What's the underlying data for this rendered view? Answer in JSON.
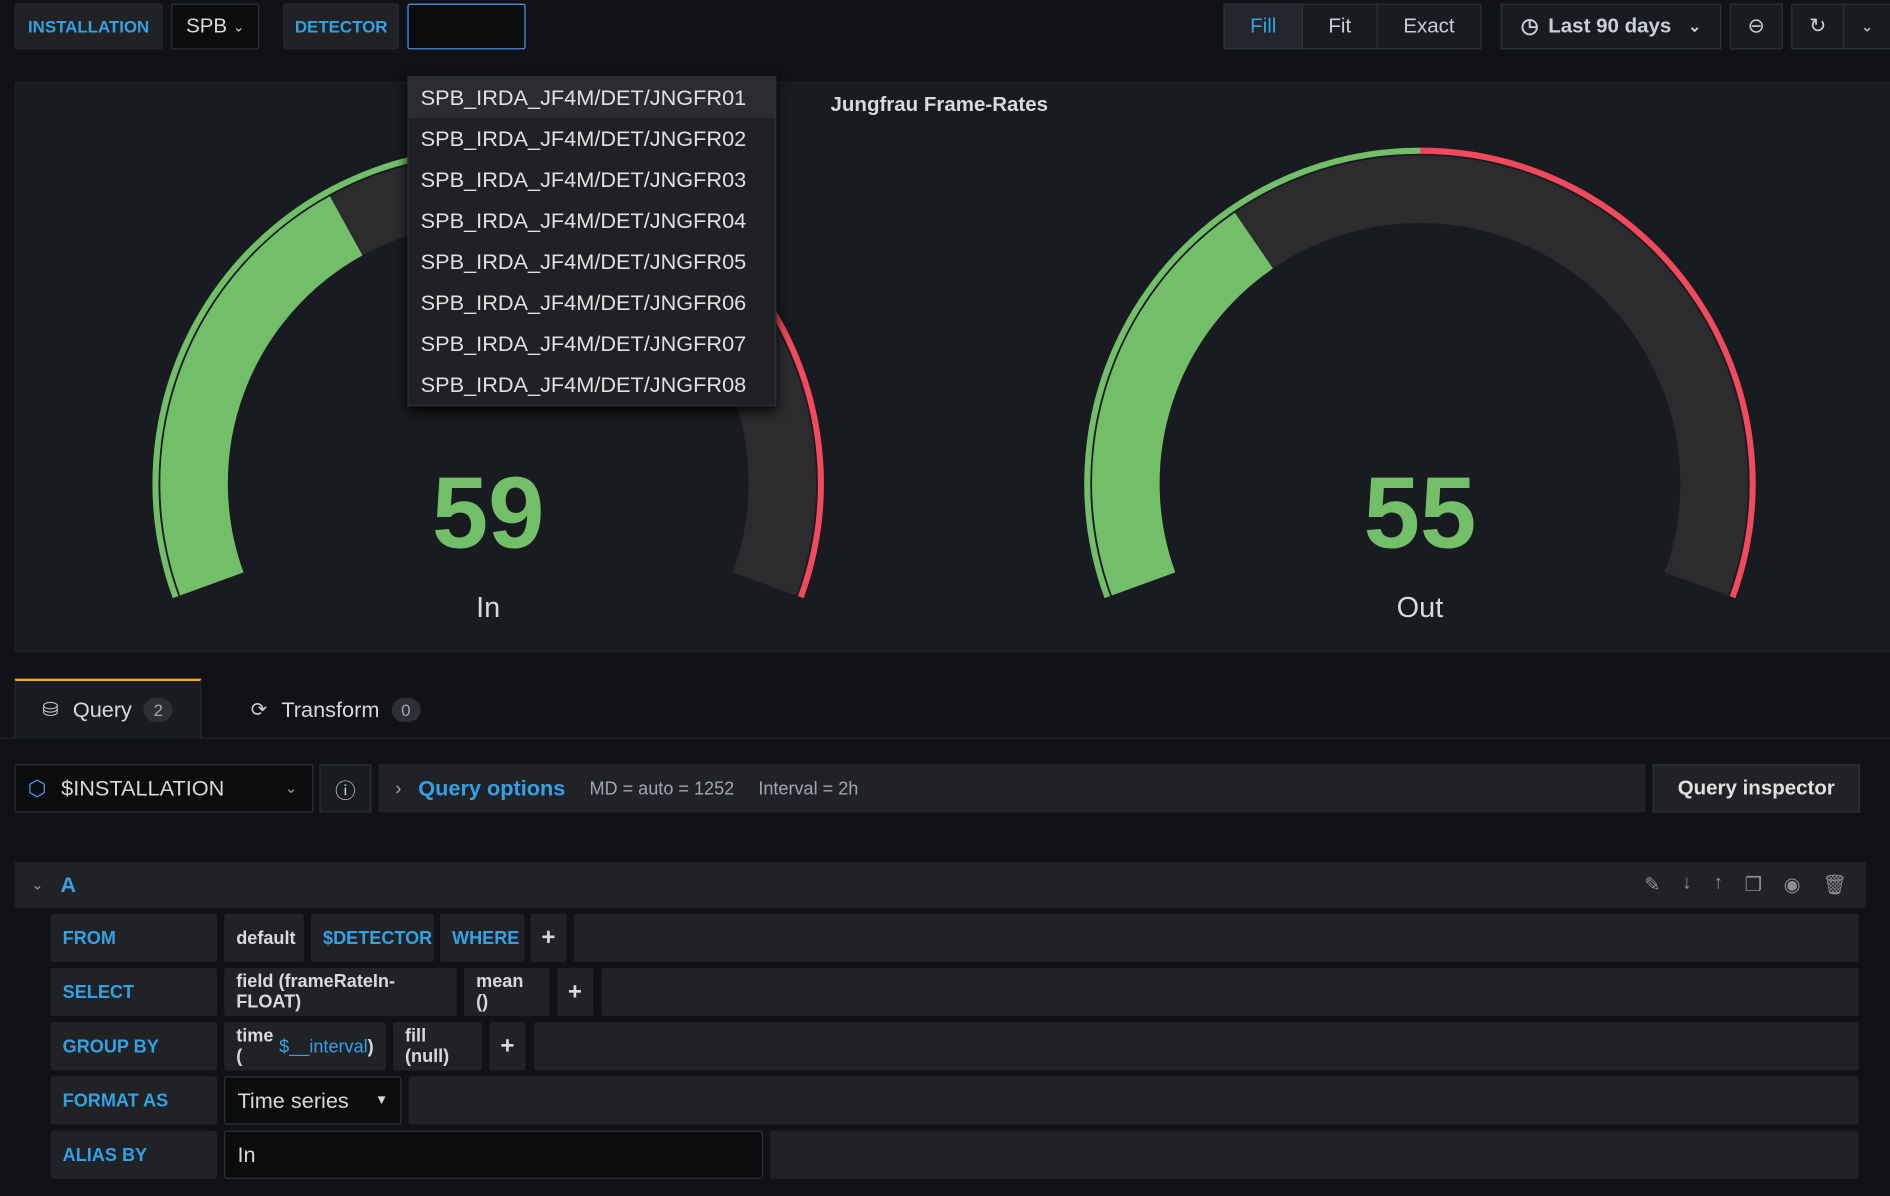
{
  "variables": {
    "installation_label": "INSTALLATION",
    "installation_value": "SPB",
    "detector_label": "DETECTOR",
    "detector_value": ""
  },
  "toolbar": {
    "fill": "Fill",
    "fit": "Fit",
    "exact": "Exact",
    "time_range": "Last 90 days"
  },
  "detector_options": [
    "SPB_IRDA_JF4M/DET/JNGFR01",
    "SPB_IRDA_JF4M/DET/JNGFR02",
    "SPB_IRDA_JF4M/DET/JNGFR03",
    "SPB_IRDA_JF4M/DET/JNGFR04",
    "SPB_IRDA_JF4M/DET/JNGFR05",
    "SPB_IRDA_JF4M/DET/JNGFR06",
    "SPB_IRDA_JF4M/DET/JNGFR07",
    "SPB_IRDA_JF4M/DET/JNGFR08"
  ],
  "panel": {
    "title": "Jungfrau Frame-Rates"
  },
  "gauges": [
    {
      "label": "In",
      "value": "59",
      "num": 59
    },
    {
      "label": "Out",
      "value": "55",
      "num": 55
    }
  ],
  "gauge_config": {
    "min": 0,
    "max": 160,
    "threshold": 80,
    "ok_color": "#73bf69",
    "alert_color": "#f2495c",
    "track_color": "#2c2c2e"
  },
  "tabs": [
    {
      "label": "Query",
      "count": "2"
    },
    {
      "label": "Transform",
      "count": "0"
    }
  ],
  "query_bar": {
    "datasource": "$INSTALLATION",
    "options_label": "Query options",
    "md": "MD = auto = 1252",
    "interval": "Interval = 2h",
    "inspector": "Query inspector"
  },
  "query": {
    "ref": "A",
    "from": {
      "label": "FROM",
      "policy": "default",
      "measurement": "$DETECTOR",
      "where": "WHERE"
    },
    "select": {
      "label": "SELECT",
      "field": "field (frameRateIn-FLOAT)",
      "agg": "mean ()"
    },
    "group_by": {
      "label": "GROUP BY",
      "time_prefix": "time (",
      "time_var": "$__interval",
      "time_suffix": ")",
      "fill": "fill (null)"
    },
    "format_as": {
      "label": "FORMAT AS",
      "value": "Time series"
    },
    "alias_by": {
      "label": "ALIAS BY",
      "value": "In"
    }
  }
}
